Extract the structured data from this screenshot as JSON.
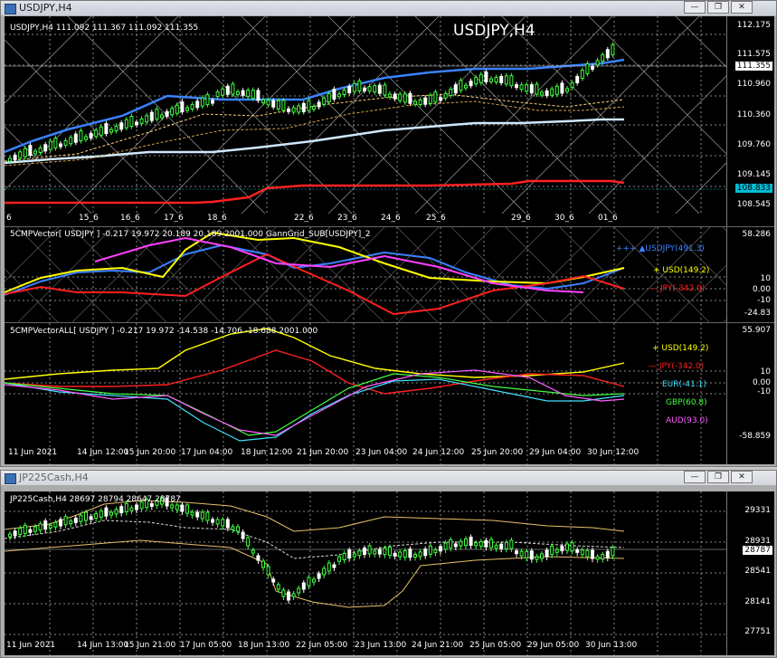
{
  "main_window": {
    "title": "USDJPY,H4",
    "price_header": "USDJPY,H4  111.092 111.367 111.092 111.355",
    "chart_name": "USDJPY,H4",
    "price_ticks": [
      "112.175",
      "111.575",
      "110.960",
      "110.360",
      "109.760",
      "109.145",
      "108.545"
    ],
    "current_price": "111.355",
    "level_price": "108.833",
    "date_ticks": [
      "6",
      "15_6",
      "16_6",
      "17_6",
      "18_6",
      "22_6",
      "23_6",
      "24_6",
      "25_6",
      "29_6",
      "30_6",
      "01_6"
    ],
    "indicator1": {
      "header": "5CMPVector[ USDJPY ] -0.217 19.972 20.189 20.189 2001.000  GannGrid_SUB[USDJPY]_2",
      "ticks": [
        "58.286",
        "10",
        "0.00",
        "-10",
        "-24.83"
      ],
      "legend": [
        {
          "text": "+++ ▲USDJPY(491.3)",
          "color": "#3a82ff"
        },
        {
          "text": "+ USD(149.2)",
          "color": "#ffff00"
        },
        {
          "text": "— JPY(-342.0)",
          "color": "#ff2020"
        }
      ]
    },
    "indicator2": {
      "header": "5CMPVectorALL[ USDJPY ] -0.217 19.972 -14.538 -14.706 -18.688 2001.000",
      "ticks": [
        "55.907",
        "10",
        "0.00",
        "-10",
        "-58.859"
      ],
      "legend": [
        {
          "text": "+ USD(149.2)",
          "color": "#ffff00"
        },
        {
          "text": "— JPY(-342.0)",
          "color": "#ff2020"
        },
        {
          "text": "EUR(-41.1)",
          "color": "#40e0ff"
        },
        {
          "text": "GBP(60.8)",
          "color": "#40ff40"
        },
        {
          "text": "AUD(93.0)",
          "color": "#ff60ff"
        }
      ]
    },
    "time_ticks": [
      "11 Jun 2021",
      "14 Jun 12:00",
      "15 Jun 20:00",
      "17 Jun 04:00",
      "18 Jun 12:00",
      "21 Jun 20:00",
      "23 Jun 04:00",
      "24 Jun 12:00",
      "25 Jun 20:00",
      "29 Jun 04:00",
      "30 Jun 12:00"
    ]
  },
  "second_window": {
    "title": "JP225Cash,H4",
    "price_header": "JP225Cash,H4  28697 28794 28647 28787",
    "price_ticks": [
      "29331",
      "28931",
      "28541",
      "28141",
      "27751"
    ],
    "current_price": "28787",
    "time_ticks": [
      "11 Jun 2021",
      "14 Jun 13:00",
      "15 Jun 21:00",
      "17 Jun 05:00",
      "18 Jun 13:00",
      "22 Jun 05:00",
      "23 Jun 13:00",
      "24 Jun 21:00",
      "25 Jun 05:00",
      "29 Jun 05:00",
      "30 Jun 13:00"
    ]
  },
  "window_buttons": {
    "minimize": "—",
    "restore": "❐",
    "close": "✕"
  },
  "colors": {
    "bull": "#40ff40",
    "bear": "#ffffff",
    "upper_band": "#3a82ff",
    "lower_band": "#bfe3ff",
    "red_level": "#ff2020"
  }
}
